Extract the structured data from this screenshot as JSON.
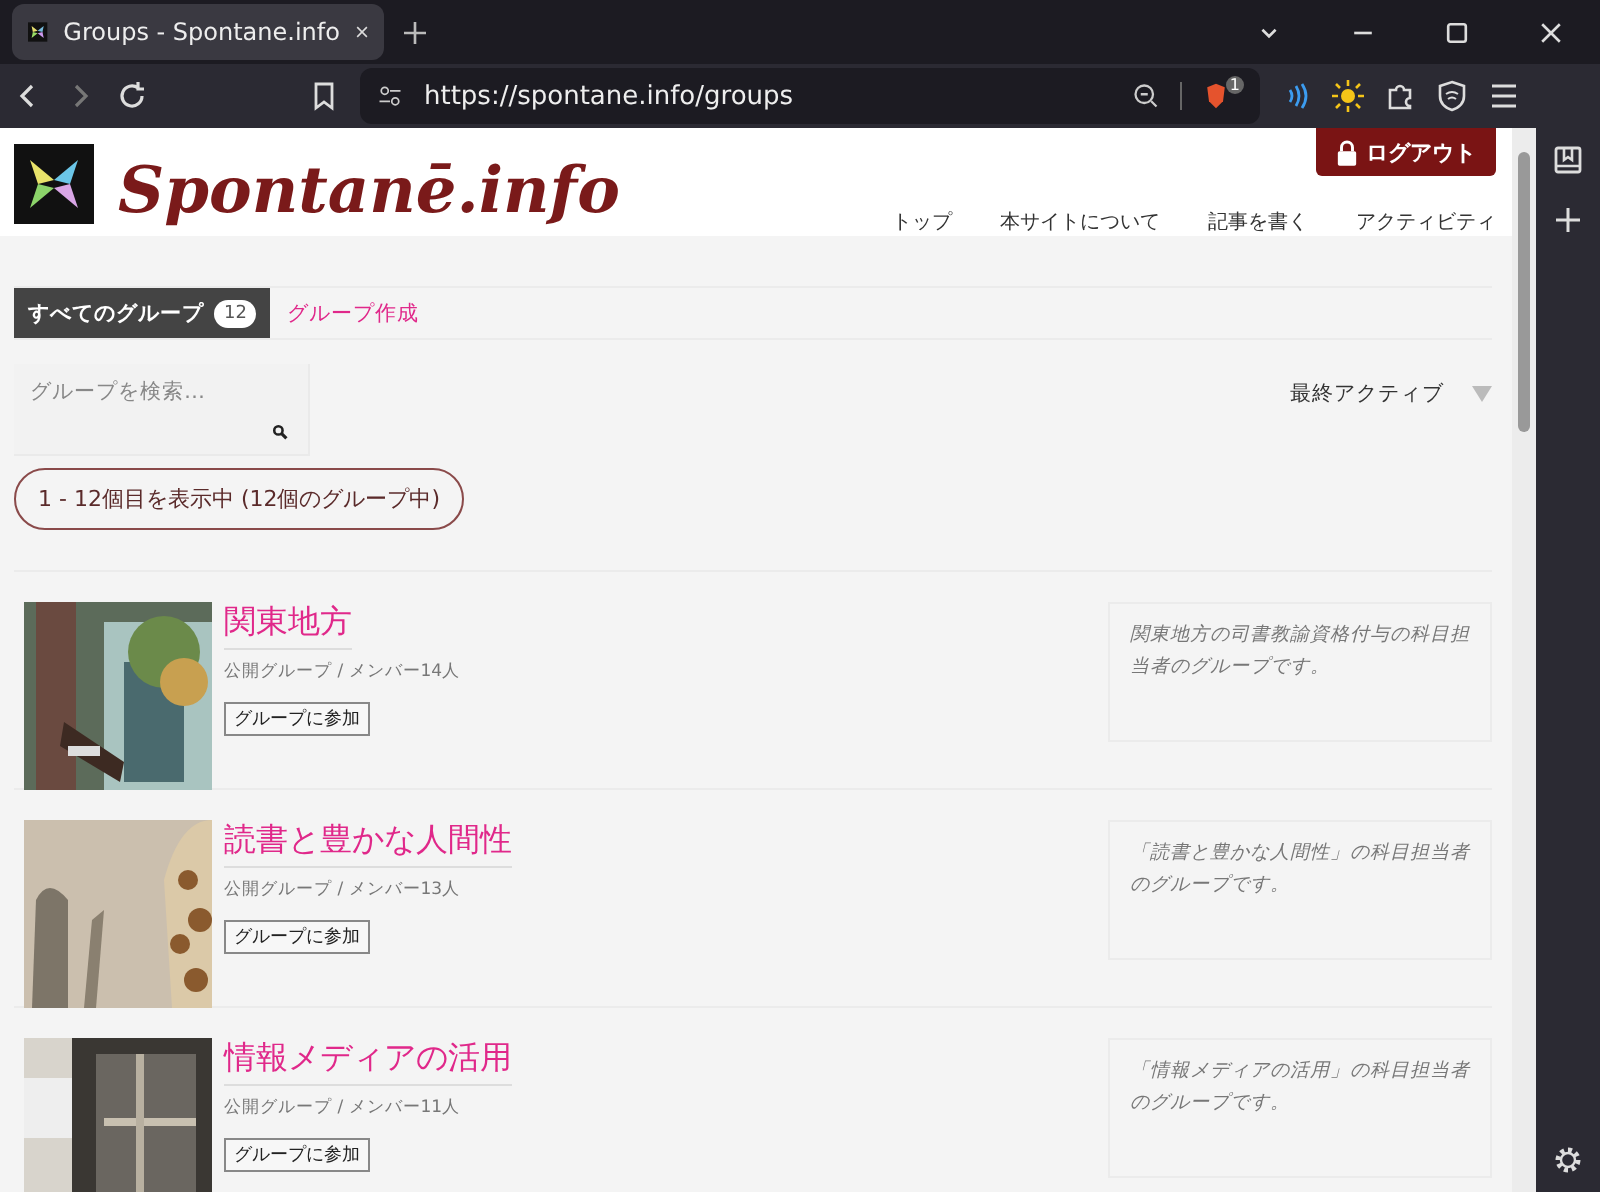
{
  "browser": {
    "tab_title": "Groups - Spontane.info",
    "url": "https://spontane.info/groups",
    "shield_badge": "1"
  },
  "site": {
    "logo_text": "Spontanē.info",
    "logout": "ログアウト",
    "nav": [
      "トップ",
      "本サイトについて",
      "記事を書く",
      "アクティビティ"
    ]
  },
  "tabs": [
    {
      "label": "すべてのグループ",
      "count": "12",
      "selected": true
    },
    {
      "label": "グループ作成",
      "selected": false
    }
  ],
  "search": {
    "placeholder": "グループを検索…"
  },
  "sort": {
    "label": "最終アクティブ"
  },
  "pagination": "1 - 12個目を表示中 (12個のグループ中)",
  "groups": [
    {
      "name": "関東地方",
      "meta": "公開グループ / メンバー14人",
      "join": "グループに参加",
      "description": "関東地方の司書教諭資格付与の科目担当者のグループです。"
    },
    {
      "name": "読書と豊かな人間性",
      "meta": "公開グループ / メンバー13人",
      "join": "グループに参加",
      "description": "「読書と豊かな人間性」の科目担当者のグループです。"
    },
    {
      "name": "情報メディアの活用",
      "meta": "公開グループ / メンバー11人",
      "join": "グループに参加",
      "description": "「情報メディアの活用」の科目担当者のグループです。"
    }
  ]
}
